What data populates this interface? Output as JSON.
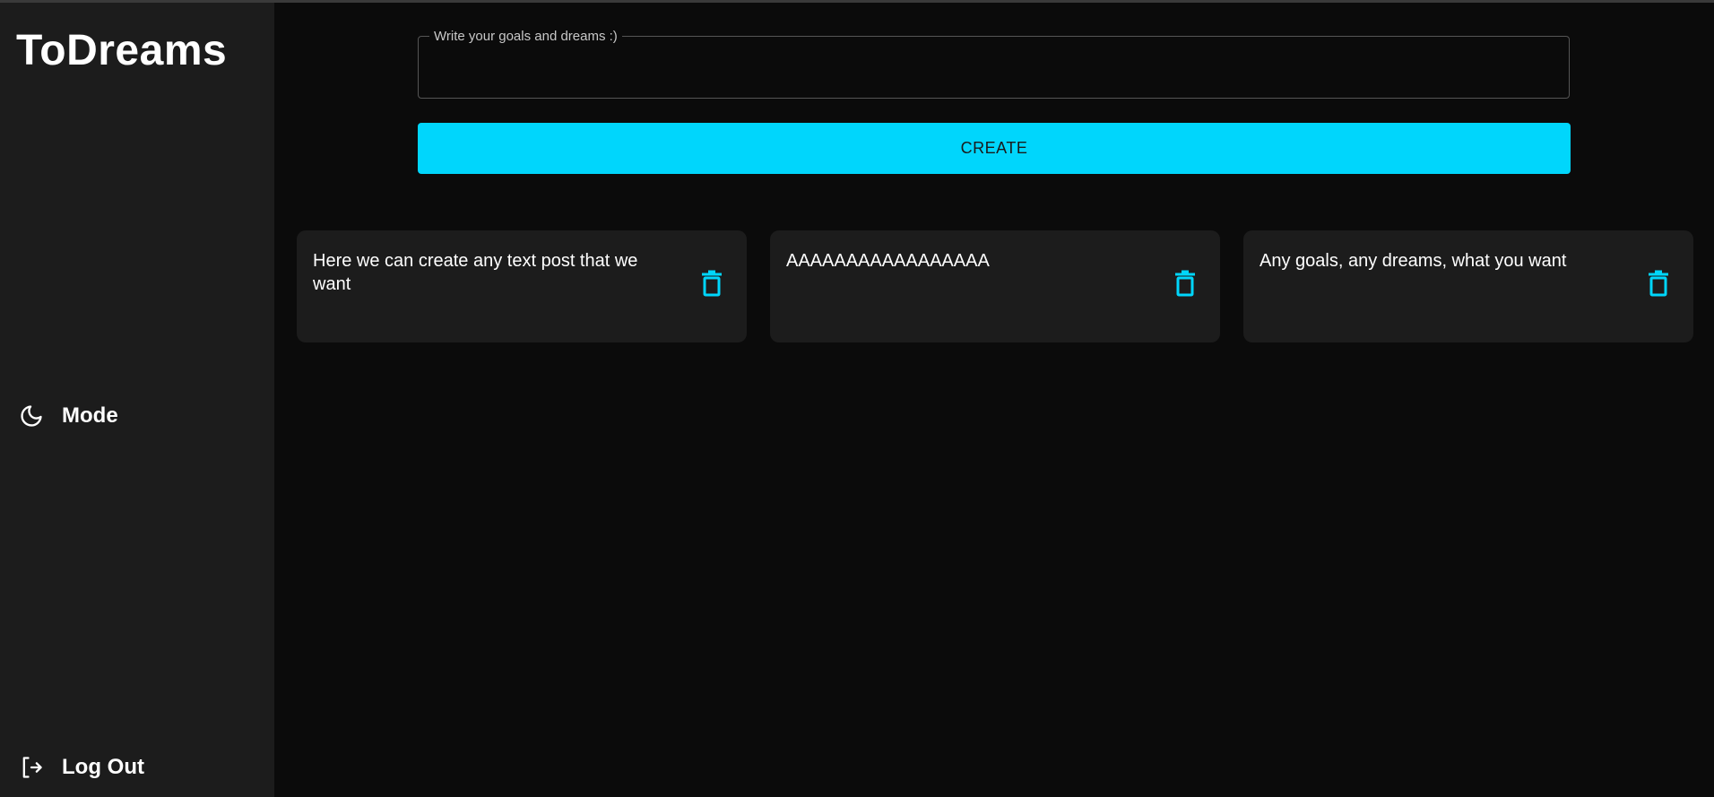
{
  "app": {
    "title": "ToDreams"
  },
  "sidebar": {
    "mode": {
      "label": "Mode",
      "icon": "moon-icon"
    },
    "logout": {
      "label": "Log Out",
      "icon": "logout-icon"
    }
  },
  "form": {
    "goal_label": "Write your goals and dreams :)",
    "goal_value": "",
    "create_label": "CREATE"
  },
  "posts": [
    {
      "text": "Here we can create any text post that we want",
      "action_icon": "trash-icon"
    },
    {
      "text": "AAAAAAAAAAAAAAAAA",
      "action_icon": "trash-icon"
    },
    {
      "text": "Any goals, any dreams, what you want",
      "action_icon": "trash-icon"
    }
  ],
  "colors": {
    "accent": "#00d6fc",
    "sidebar_bg": "#1c1c1c",
    "main_bg": "#0b0b0b",
    "card_bg": "#1c1c1c"
  }
}
